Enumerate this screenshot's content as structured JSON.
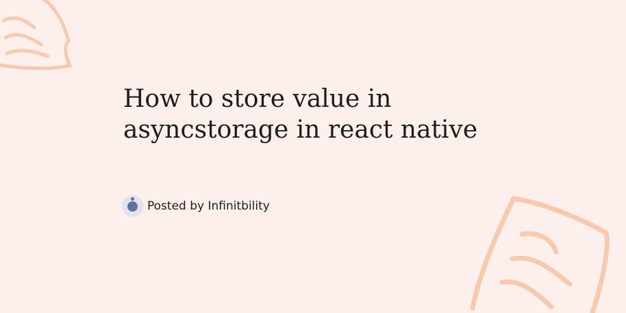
{
  "post": {
    "title": "How to store value in asyncstorage in react native",
    "author_label": "Posted by Infinitbility"
  },
  "icons": {
    "avatar": "author-avatar-icon",
    "decoration": "doodle-note-icon"
  },
  "colors": {
    "background": "#fdf0ec",
    "doodle": "#f7c9ae",
    "avatar": "#5f73a0"
  }
}
